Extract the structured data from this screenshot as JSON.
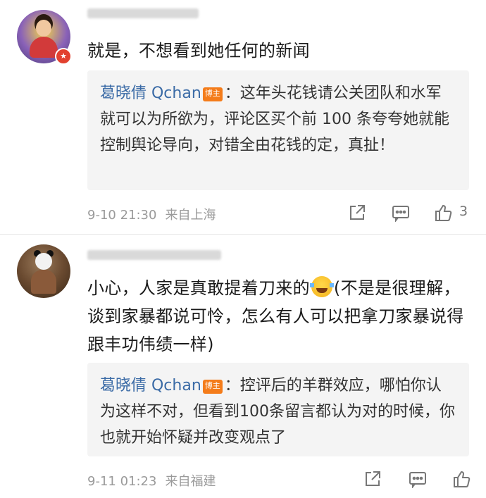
{
  "comments": [
    {
      "avatar_icon": "user-avatar-icon",
      "verified_icon": "verified-badge-icon",
      "verified_glyph": "★",
      "text": "就是，不想看到她任何的新闻",
      "reply": {
        "author": "葛晓倩 Qchan",
        "badge": "博主",
        "text": "：这年头花钱请公关团队和水军就可以为所欲为，评论区买个前 100 条夸夸她就能控制舆论导向，对错全由花钱的定，真扯！"
      },
      "time": "9-10 21:30",
      "location": "来自上海",
      "likes": "3"
    },
    {
      "avatar_icon": "user-avatar-icon",
      "text_before_emoji": "小心，人家是真敢提着刀来的",
      "emoji": "laughing-crying-emoji",
      "text_after_emoji": "(不是是很理解，谈到家暴都说可怜，怎么有人可以把拿刀家暴说得跟丰功伟绩一样)",
      "reply": {
        "author": "葛晓倩 Qchan",
        "badge": "博主",
        "text": "：控评后的羊群效应，哪怕你认为这样不对，但看到100条留言都认为对的时候，你也就开始怀疑并改变观点了"
      },
      "time": "9-11 01:23",
      "location": "来自福建"
    }
  ],
  "colors": {
    "reply_author": "#3b6ba6",
    "badge_bg": "#f47c1a",
    "reply_bg": "#f4f4f4",
    "meta_text": "#9a9a9a"
  }
}
